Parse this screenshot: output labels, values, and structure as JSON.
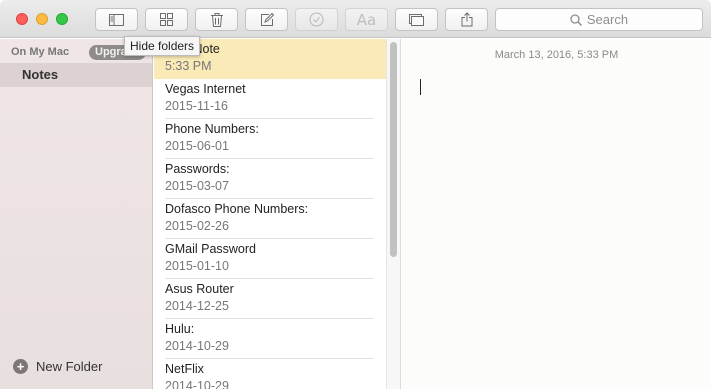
{
  "toolbar": {
    "buttons": [
      {
        "icon": "sidebar-icon"
      },
      {
        "icon": "attachments-grid-icon"
      },
      {
        "icon": "trash-icon"
      },
      {
        "icon": "compose-icon"
      },
      {
        "icon": "checkmark-icon"
      },
      {
        "icon": "font-icon",
        "label": "Aa"
      },
      {
        "icon": "gallery-icon"
      },
      {
        "icon": "share-icon"
      }
    ],
    "search_placeholder": "Search"
  },
  "tooltip": "Hide folders",
  "sidebar": {
    "account": "On My Mac",
    "upgrade_label": "Upgrade",
    "folders": [
      {
        "label": "Notes"
      }
    ],
    "new_folder_label": "New Folder"
  },
  "notes": [
    {
      "title": "New Note",
      "date": "5:33 PM",
      "selected": true
    },
    {
      "title": "Vegas Internet",
      "date": "2015-11-16"
    },
    {
      "title": "Phone Numbers:",
      "date": "2015-06-01"
    },
    {
      "title": "Passwords:",
      "date": "2015-03-07"
    },
    {
      "title": "Dofasco Phone Numbers:",
      "date": "2015-02-26"
    },
    {
      "title": "GMail Password",
      "date": "2015-01-10"
    },
    {
      "title": "Asus Router",
      "date": "2014-12-25"
    },
    {
      "title": "Hulu:",
      "date": "2014-10-29"
    },
    {
      "title": "NetFlix",
      "date": "2014-10-29"
    }
  ],
  "editor": {
    "timestamp": "March 13, 2016, 5:33 PM"
  },
  "colors": {
    "selected_note": "#faeab7",
    "sidebar_bg": "#ece3e2",
    "close": "#fc605c",
    "minimize": "#fdbc40",
    "maximize": "#34c84a"
  }
}
